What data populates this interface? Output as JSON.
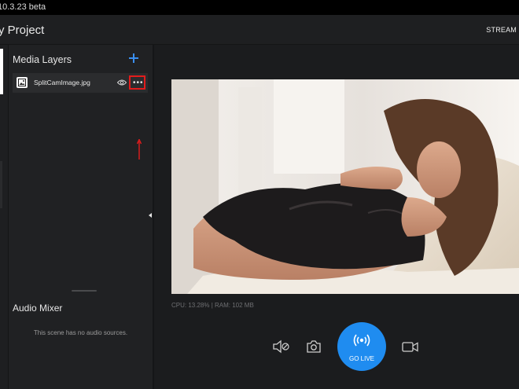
{
  "window": {
    "title": "10.3.23 beta"
  },
  "header": {
    "project_title": "y Project",
    "stream_label": "STREAM"
  },
  "media_layers": {
    "title": "Media Layers",
    "add_icon": "plus-icon",
    "items": [
      {
        "name": "SplitCamImage.jpg",
        "icon": "image-icon",
        "visibility_icon": "eye-icon",
        "menu_icon": "more-dots-icon"
      }
    ]
  },
  "audio_mixer": {
    "title": "Audio Mixer",
    "empty_text": "This scene has no audio sources."
  },
  "status": {
    "stats": "CPU: 13.28% | RAM: 102 MB"
  },
  "controls": {
    "mute_icon": "speaker-mute-icon",
    "snapshot_icon": "camera-icon",
    "go_live_label": "GO LIVE",
    "go_live_icon": "broadcast-icon",
    "record_icon": "video-camera-icon"
  },
  "colors": {
    "accent": "#1f8cf0",
    "highlight": "#e21c1c",
    "background": "#1b1c1e",
    "panel": "#202123"
  }
}
